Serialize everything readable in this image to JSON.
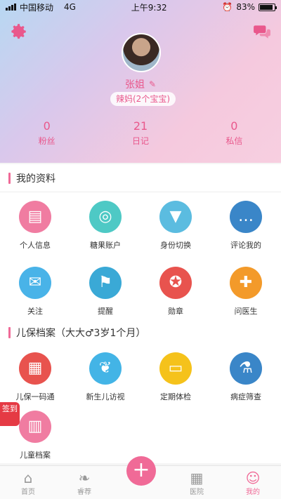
{
  "status_bar": {
    "carrier": "中国移动",
    "network": "4G",
    "time": "上午9:32",
    "battery": "83%"
  },
  "profile": {
    "name": "张姐",
    "badge": "辣妈(2个宝宝)"
  },
  "stats": [
    {
      "value": "0",
      "label": "粉丝"
    },
    {
      "value": "21",
      "label": "日记"
    },
    {
      "value": "0",
      "label": "私信"
    }
  ],
  "my_info": {
    "title": "我的资料",
    "items": [
      {
        "label": "个人信息",
        "icon": "id-card-icon",
        "color": "#f07ca1"
      },
      {
        "label": "糖果账户",
        "icon": "lollipop-icon",
        "color": "#4ec9c5"
      },
      {
        "label": "身份切换",
        "icon": "clothes-hanger-icon",
        "color": "#5bbce0"
      },
      {
        "label": "评论我的",
        "icon": "speech-bubbles-icon",
        "color": "#3a86c8"
      },
      {
        "label": "关注",
        "icon": "message-bottle-icon",
        "color": "#49b3e8"
      },
      {
        "label": "提醒",
        "icon": "mailbox-icon",
        "color": "#3aa9d6"
      },
      {
        "label": "勋章",
        "icon": "certificate-icon",
        "color": "#e8534e"
      },
      {
        "label": "问医生",
        "icon": "doctor-badge-icon",
        "color": "#f39a2a"
      }
    ]
  },
  "child_health": {
    "title": "儿保档案（大大♂3岁1个月）",
    "items": [
      {
        "label": "儿保一码通",
        "icon": "newspaper-icon",
        "color": "#e8534e"
      },
      {
        "label": "新生儿访视",
        "icon": "bird-icon",
        "color": "#43b4e6"
      },
      {
        "label": "定期体检",
        "icon": "monitor-icon",
        "color": "#f5c21b"
      },
      {
        "label": "病症筛查",
        "icon": "microscope-icon",
        "color": "#3a86c8"
      },
      {
        "label": "儿童档案",
        "icon": "clipboard-icon",
        "color": "#f07ca1"
      }
    ]
  },
  "sign_in": "签到",
  "tabbar": [
    {
      "label": "首页",
      "icon": "home-icon"
    },
    {
      "label": "睿荐",
      "icon": "feather-icon"
    },
    {
      "label": "",
      "icon": "plus-icon"
    },
    {
      "label": "医院",
      "icon": "hospital-icon"
    },
    {
      "label": "我的",
      "icon": "person-icon"
    }
  ]
}
